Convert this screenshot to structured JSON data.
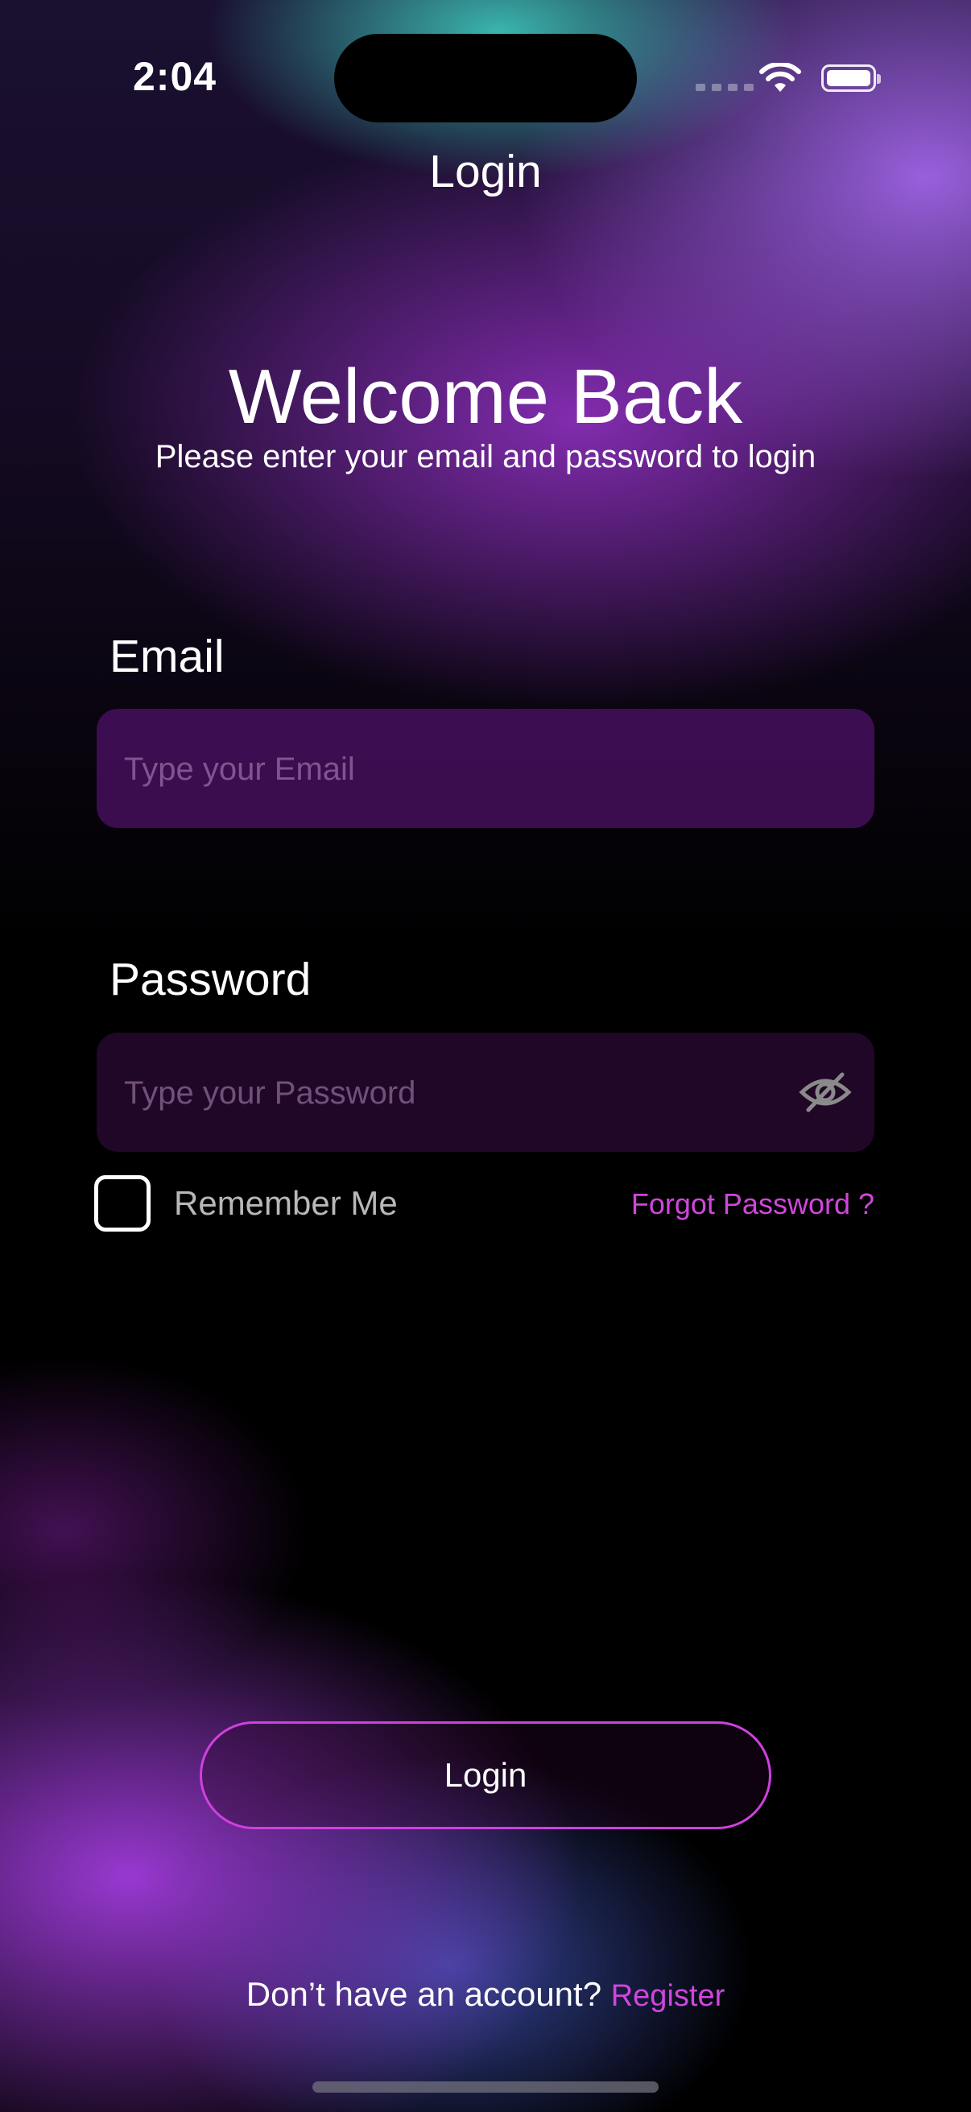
{
  "status_bar": {
    "time": "2:04"
  },
  "nav": {
    "title": "Login"
  },
  "header": {
    "title": "Welcome Back",
    "subtitle": "Please enter your email and password to login"
  },
  "form": {
    "email": {
      "label": "Email",
      "placeholder": "Type your Email",
      "value": ""
    },
    "password": {
      "label": "Password",
      "placeholder": "Type your Password",
      "value": "",
      "toggle_icon": "eye-slash-icon"
    },
    "remember_me": {
      "label": "Remember Me",
      "checked": false
    },
    "forgot_password": "Forgot Password ?"
  },
  "actions": {
    "login_label": "Login"
  },
  "footer": {
    "prompt": "Don’t have an account?",
    "register_label": "Register"
  },
  "colors": {
    "accent": "#d046dc",
    "background": "#000000"
  }
}
